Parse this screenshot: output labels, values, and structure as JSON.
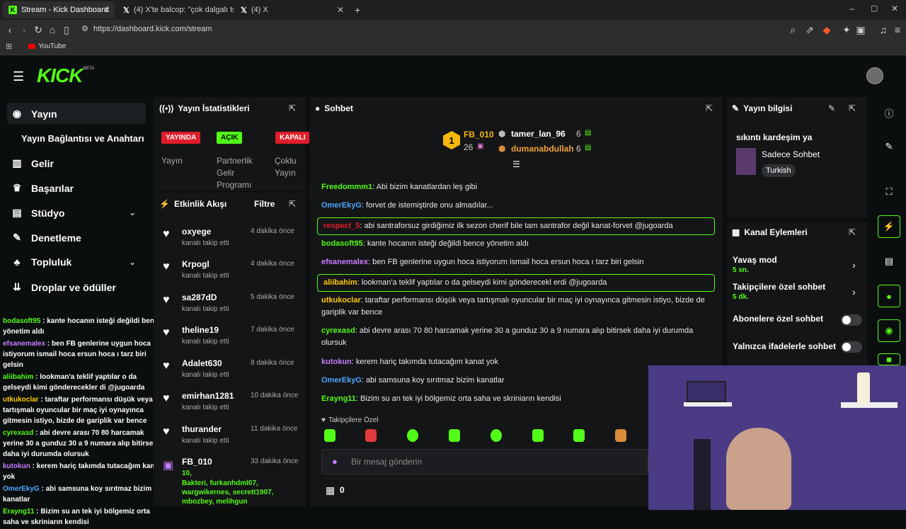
{
  "browser": {
    "tabs": [
      {
        "label": "Stream - Kick Dashboard",
        "active": true
      },
      {
        "label": "(4) X'te balcop: \"çok dalgalı tsunami o",
        "active": false
      },
      {
        "label": "(4) X",
        "active": false
      }
    ],
    "new_tab": "+",
    "url": "https://dashboard.kick.com/stream",
    "bookmark": "YouTube",
    "window_controls": {
      "minimize": "–",
      "maximize": "▢",
      "close": "✕"
    }
  },
  "header": {
    "logo": "KICK",
    "beta": "BETA"
  },
  "sidebar": {
    "items": [
      {
        "label": "Yayın",
        "icon": "broadcast-icon"
      },
      {
        "label": "Yayın Bağlantısı ve Anahtarı",
        "icon": ""
      },
      {
        "label": "Gelir",
        "icon": "chart-icon"
      },
      {
        "label": "Başarılar",
        "icon": "trophy-icon"
      },
      {
        "label": "Stüdyo",
        "icon": "studio-icon"
      },
      {
        "label": "Denetleme",
        "icon": "wrench-icon"
      },
      {
        "label": "Topluluk",
        "icon": "community-icon"
      },
      {
        "label": "Droplar ve ödüller",
        "icon": "drops-icon"
      }
    ]
  },
  "minichat": [
    {
      "user": "bodasoft95",
      "color": "#53fc18",
      "text": "kante hocanın isteği değildi bence yönetim aldı"
    },
    {
      "user": "efsanemalex",
      "color": "#c87cff",
      "text": "ben FB genlerine uygun hoca istiyorum ismail hoca ersun hoca ı tarz biri gelsin"
    },
    {
      "user": "aliibahim",
      "color": "#53fc18",
      "text": "lookman'a teklif yaptılar o da gelseydi kimi gönderecekler di @jugoarda"
    },
    {
      "user": "utkukoclar",
      "color": "#ffcc00",
      "text": "taraftar performansı düşük veya tartışmalı oyuncular bir maç iyi oynayınca gitmesin istiyo, bizde de gariplik var bence"
    },
    {
      "user": "cyrexasd",
      "color": "#53fc18",
      "text": "abi devre arası 70 80 harcamak yerine 30 a gunduz 30 a 9 numara alıp bitirsek daha iyi durumda olursuk"
    },
    {
      "user": "kutokun",
      "color": "#c87cff",
      "text": "kerem hariç takımda tutacağım kanat yok"
    },
    {
      "user": "OmerEkyG",
      "color": "#4da6ff",
      "text": "abi samsuna koy sırıtmaz bizim kanatlar"
    },
    {
      "user": "Erayng11",
      "color": "#53fc18",
      "text": "Bizim su an tek iyi bölgemiz orta saha ve skriniarın kendisi"
    }
  ],
  "stats": {
    "title": "Yayın İstatistikleri",
    "badges": [
      {
        "label": "YAYINDA",
        "color": "#e11d2b",
        "caption": "Yayın"
      },
      {
        "label": "AÇIK",
        "color": "#53fc18",
        "caption": "Partnerlik Gelir Programı"
      },
      {
        "label": "KAPALI",
        "color": "#e11d2b",
        "caption": "Çoklu Yayın"
      }
    ]
  },
  "activity": {
    "title": "Etkinlik Akışı",
    "filter": "Filtre",
    "items": [
      {
        "name": "oxyege",
        "time": "4 dakika önce",
        "sub": "kanalı takip etti"
      },
      {
        "name": "Krpogl",
        "time": "4 dakika önce",
        "sub": "kanalı takip etti"
      },
      {
        "name": "sa287dD",
        "time": "5 dakika önce",
        "sub": "kanalı takip etti"
      },
      {
        "name": "theline19",
        "time": "7 dakika önce",
        "sub": "kanalı takip etti"
      },
      {
        "name": "Adalet630",
        "time": "8 dakika önce",
        "sub": "kanalı takip etti"
      },
      {
        "name": "emirhan1281",
        "time": "10 dakika önce",
        "sub": "kanalı takip etti"
      },
      {
        "name": "thurander",
        "time": "11 dakika önce",
        "sub": "kanalı takip etti"
      }
    ],
    "gift": {
      "name": "FB_010",
      "time": "33 dakika önce",
      "count": "10,",
      "recipients": "Bakteri, furkanhdml07, wargwikernes, secrett1907, mbozbey, melihgun"
    }
  },
  "chat": {
    "title": "Sohbet",
    "leaderboard": [
      {
        "rank": "1",
        "name": "FB_010",
        "count": "26"
      },
      {
        "name": "tamer_lan_96",
        "count": "6"
      },
      {
        "name": "dumanabdullah",
        "count": "6"
      }
    ],
    "messages": [
      {
        "user": "Freedommm1",
        "color": "#53fc18",
        "text": "Abi bizim kanatlardan leş gibi",
        "hl": false
      },
      {
        "user": "OmerEkyG",
        "color": "#4da6ff",
        "text": "forvet de istemiştirde onu almadılar...",
        "hl": false
      },
      {
        "user": "respect_5",
        "color": "#e11d2b",
        "text": "abi santraforsuz girdiğimiz ilk sezon cherif bile tam santrafor değil kanat-forvet @jugoarda",
        "hl": true
      },
      {
        "user": "bodasoft95",
        "color": "#53fc18",
        "text": "kante hocanın isteği değildi bence yönetim aldı",
        "hl": false
      },
      {
        "user": "efsanemalex",
        "color": "#c87cff",
        "text": "ben FB genlerine uygun hoca istiyorum ismail hoca ersun hoca ı tarz biri gelsin",
        "hl": false
      },
      {
        "user": "aliibahim",
        "color": "#ffcc00",
        "text": "lookman'a teklif yaptılar o da gelseydi kimi gönderecekl erdi @jugoarda",
        "hl": true
      },
      {
        "user": "utkukoclar",
        "color": "#ffcc00",
        "text": "taraftar performansı düşük veya tartışmalı oyuncular bir maç iyi oynayınca gitmesin istiyo, bizde de gariplik var bence",
        "hl": false
      },
      {
        "user": "cyrexasd",
        "color": "#53fc18",
        "text": "abi devre arası 70 80 harcamak yerine 30 a gunduz 30 a 9 numara alıp bitirsek daha iyi durumda olursuk",
        "hl": false
      },
      {
        "user": "kutokun",
        "color": "#c87cff",
        "text": "kerem hariç takımda tutacağım kanat yok",
        "hl": false
      },
      {
        "user": "OmerEkyG",
        "color": "#4da6ff",
        "text": "abi samsuna koy sırıtmaz bizim kanatlar",
        "hl": false
      },
      {
        "user": "Erayng11",
        "color": "#53fc18",
        "text": "Bizim su an tek iyi bölgemiz orta saha ve skriniarın kendisi",
        "hl": false
      }
    ],
    "followers_only": "Takipçilere Özel",
    "placeholder": "Bir mesaj gönderin",
    "points": "0"
  },
  "stream_info": {
    "title": "Yayın bilgisi",
    "stream_title": "sıkıntı kardeşim ya",
    "category": "Sadece Sohbet",
    "tag": "Turkish"
  },
  "channel_actions": {
    "title": "Kanal Eylemleri",
    "slow_mode": "Yavaş mod",
    "slow_value": "5 sn.",
    "followers_chat": "Takipçilere özel sohbet",
    "followers_value": "5 dk.",
    "subs_chat": "Abonelere özel sohbet",
    "emote_chat": "Yalnızca ifadelerle sohbet"
  },
  "colors": {
    "accent": "#53fc18",
    "live": "#e11d2b",
    "panel": "#141517"
  }
}
